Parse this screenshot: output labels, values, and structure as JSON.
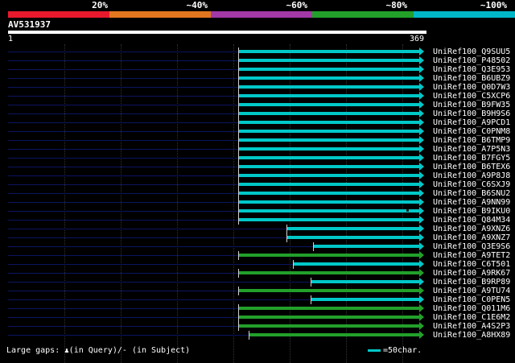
{
  "identity_scale": {
    "labels": [
      "20%",
      "~40%",
      "~60%",
      "~80%",
      "~100%"
    ],
    "colors": [
      "#e8192c",
      "#e2761f",
      "#a239a6",
      "#22a02a",
      "#00b7c8"
    ]
  },
  "query": {
    "id": "AV531937",
    "start": "1",
    "end": "369"
  },
  "hits": [
    {
      "label": "UniRef100_Q9SUU5",
      "start": 296,
      "color": "#00c8c8"
    },
    {
      "label": "UniRef100_P48502",
      "start": 296,
      "color": "#00c8c8"
    },
    {
      "label": "UniRef100_Q3E953",
      "start": 296,
      "color": "#00c8c8"
    },
    {
      "label": "UniRef100_B6UBZ9",
      "start": 296,
      "color": "#00c8c8"
    },
    {
      "label": "UniRef100_Q0D7W3",
      "start": 296,
      "color": "#00c8c8"
    },
    {
      "label": "UniRef100_C5XCP6",
      "start": 296,
      "color": "#00c8c8"
    },
    {
      "label": "UniRef100_B9FW35",
      "start": 296,
      "color": "#00c8c8"
    },
    {
      "label": "UniRef100_B9H9S6",
      "start": 296,
      "color": "#00c8c8"
    },
    {
      "label": "UniRef100_A9PCD1",
      "start": 296,
      "color": "#00c8c8"
    },
    {
      "label": "UniRef100_C0PNM8",
      "start": 296,
      "color": "#00c8c8"
    },
    {
      "label": "UniRef100_B6TMP9",
      "start": 296,
      "color": "#00c8c8"
    },
    {
      "label": "UniRef100_A7P5N3",
      "start": 296,
      "color": "#00c8c8"
    },
    {
      "label": "UniRef100_B7FGY5",
      "start": 296,
      "color": "#00c8c8"
    },
    {
      "label": "UniRef100_B6TEX6",
      "start": 296,
      "color": "#00c8c8"
    },
    {
      "label": "UniRef100_A9P8J8",
      "start": 296,
      "color": "#00c8c8"
    },
    {
      "label": "UniRef100_C6SXJ9",
      "start": 296,
      "color": "#00c8c8"
    },
    {
      "label": "UniRef100_B6SNU2",
      "start": 296,
      "color": "#00c8c8"
    },
    {
      "label": "UniRef100_A9NN99",
      "start": 296,
      "color": "#00c8c8"
    },
    {
      "label": "UniRef100_B9IKU0",
      "start": 296,
      "color": "#00c8c8",
      "gap": 505
    },
    {
      "label": "UniRef100_Q84M34",
      "start": 296,
      "color": "#00c8c8"
    },
    {
      "label": "UniRef100_A9XNZ6",
      "start": 356,
      "color": "#00c8c8"
    },
    {
      "label": "UniRef100_A9XNZ7",
      "start": 356,
      "color": "#00c8c8"
    },
    {
      "label": "UniRef100_Q3E9S6",
      "start": 389,
      "color": "#00c8c8"
    },
    {
      "label": "UniRef100_A9TET2",
      "start": 296,
      "color": "#22a02a"
    },
    {
      "label": "UniRef100_C6T501",
      "start": 364,
      "color": "#00c8c8"
    },
    {
      "label": "UniRef100_A9RK67",
      "start": 296,
      "color": "#22a02a"
    },
    {
      "label": "UniRef100_B9RP89",
      "start": 386,
      "color": "#00c8c8"
    },
    {
      "label": "UniRef100_A9TU74",
      "start": 296,
      "color": "#22a02a"
    },
    {
      "label": "UniRef100_C0PEN5",
      "start": 386,
      "color": "#00c8c8"
    },
    {
      "label": "UniRef100_Q011M6",
      "start": 296,
      "color": "#22a02a"
    },
    {
      "label": "UniRef100_C1E6M2",
      "start": 296,
      "color": "#22a02a"
    },
    {
      "label": "UniRef100_A4S2P3",
      "start": 296,
      "color": "#22a02a"
    },
    {
      "label": "UniRef100_A8HX89",
      "start": 309,
      "color": "#22a02a"
    }
  ],
  "legend": {
    "gaps_text": "Large gaps: ",
    "gaps_suffix": "(in Query)/- (in Subject)",
    "scale_text": "=50char.",
    "scale_color": "#00c8c8"
  }
}
